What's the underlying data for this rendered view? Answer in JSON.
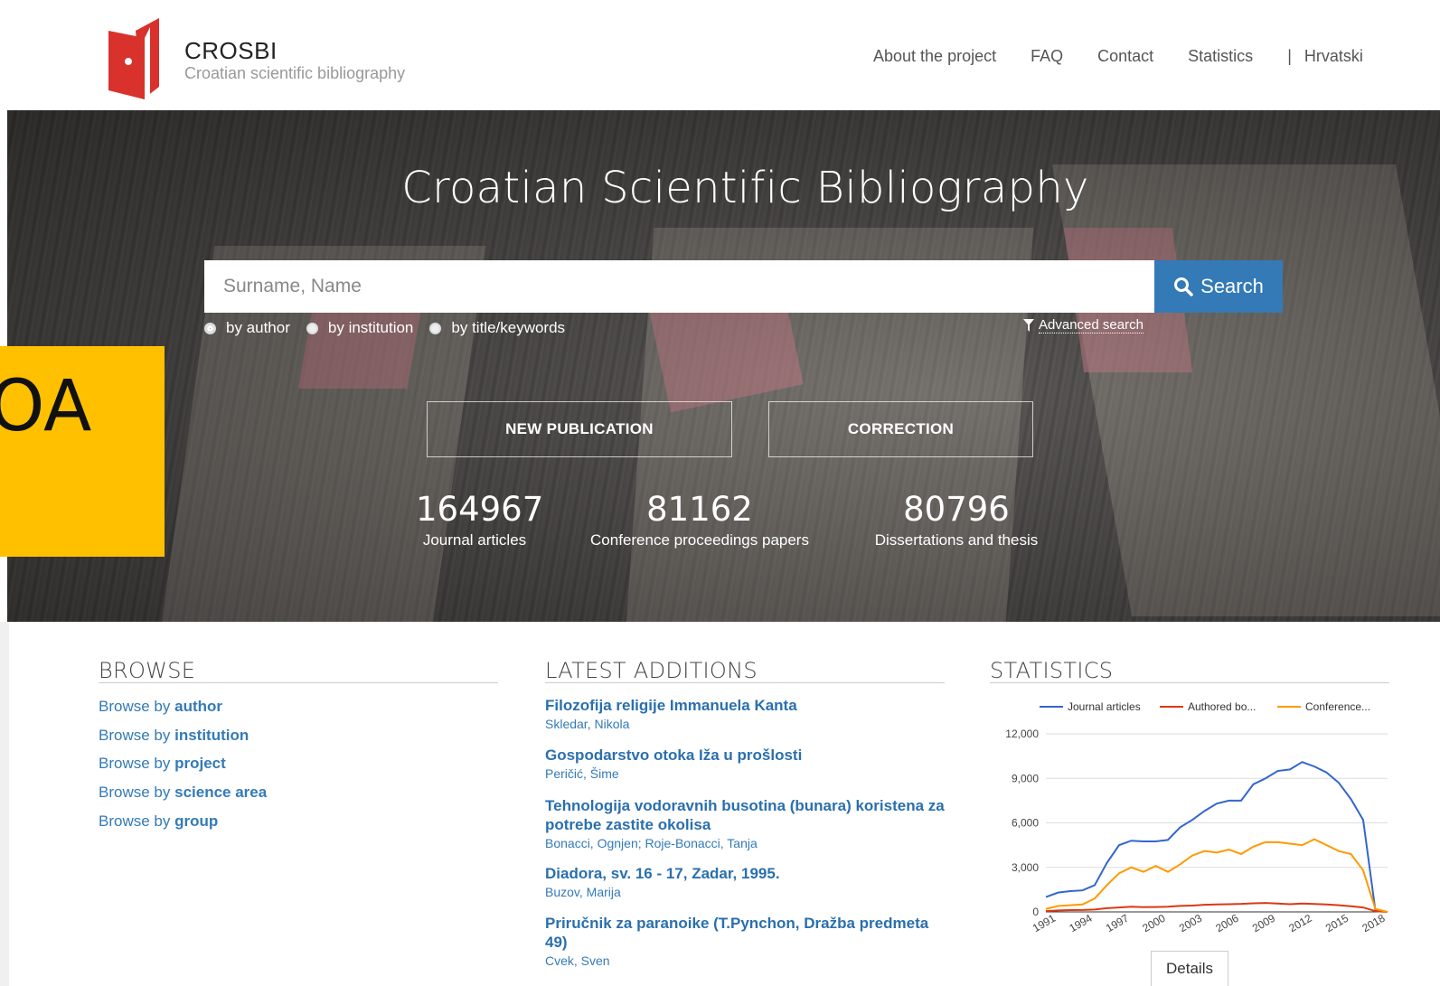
{
  "brand": {
    "name": "CROSBI",
    "subtitle": "Croatian scientific bibliography"
  },
  "nav": {
    "items": [
      "About the project",
      "FAQ",
      "Contact",
      "Statistics"
    ],
    "separator": "|",
    "language": "Hrvatski"
  },
  "hero": {
    "title": "Croatian Scientific Bibliography",
    "search_placeholder": "Surname, Name",
    "search_button": "Search",
    "radio_options": [
      "by author",
      "by institution",
      "by title/keywords"
    ],
    "radio_selected": "by author",
    "advanced_search": "Advanced search",
    "new_publication": "NEW PUBLICATION",
    "correction": "CORRECTION",
    "stats": [
      {
        "value": "164967",
        "label": "Journal articles"
      },
      {
        "value": "81162",
        "label": "Conference proceedings papers"
      },
      {
        "value": "80796",
        "label": "Dissertations and thesis"
      }
    ]
  },
  "overlay": {
    "text": "OA",
    "color": "#ffc000"
  },
  "browse": {
    "title": "BROWSE",
    "prefix": "Browse by",
    "items": [
      "author",
      "institution",
      "project",
      "science area",
      "group"
    ]
  },
  "latest": {
    "title": "LATEST ADDITIONS",
    "items": [
      {
        "title": "Filozofija religije Immanuela Kanta",
        "author": "Skledar, Nikola"
      },
      {
        "title": "Gospodarstvo otoka Iža u prošlosti",
        "author": "Peričić, Šime"
      },
      {
        "title": "Tehnologija vodoravnih busotina (bunara) koristena za potrebe zastite okolisa",
        "author": "Bonacci, Ognjen; Roje-Bonacci, Tanja"
      },
      {
        "title": "Diadora, sv. 16 - 17, Zadar, 1995.",
        "author": "Buzov, Marija"
      },
      {
        "title": "Priručnik za paranoike (T.Pynchon, Dražba predmeta 49)",
        "author": "Cvek, Sven"
      }
    ]
  },
  "statistics": {
    "title": "STATISTICS",
    "details_button": "Details"
  },
  "colors": {
    "accent": "#337ab7",
    "logo_red": "#d9312b",
    "journal": "#3366cc",
    "authored": "#dc3912",
    "conference": "#ff9900"
  },
  "chart_data": {
    "type": "line",
    "x": [
      1991,
      1992,
      1993,
      1994,
      1995,
      1996,
      1997,
      1998,
      1999,
      2000,
      2001,
      2002,
      2003,
      2004,
      2005,
      2006,
      2007,
      2008,
      2009,
      2010,
      2011,
      2012,
      2013,
      2014,
      2015,
      2016,
      2017,
      2018,
      2019
    ],
    "xticks": [
      "1991",
      "1994",
      "1997",
      "2000",
      "2003",
      "2006",
      "2009",
      "2012",
      "2015",
      "2018"
    ],
    "yticks": [
      "0",
      "3,000",
      "6,000",
      "9,000",
      "12,000"
    ],
    "ylim": [
      0,
      12000
    ],
    "series": [
      {
        "name": "Journal articles",
        "color": "#3366cc",
        "values": [
          1000,
          1300,
          1400,
          1450,
          1800,
          3300,
          4500,
          4800,
          4750,
          4750,
          4850,
          5700,
          6200,
          6800,
          7300,
          7500,
          7500,
          8600,
          9000,
          9500,
          9600,
          10100,
          9800,
          9400,
          8700,
          7600,
          6200,
          100,
          0
        ]
      },
      {
        "name": "Authored bo...",
        "color": "#dc3912",
        "values": [
          50,
          100,
          120,
          130,
          160,
          250,
          300,
          350,
          320,
          330,
          350,
          400,
          430,
          480,
          500,
          520,
          540,
          580,
          600,
          560,
          520,
          560,
          530,
          500,
          450,
          380,
          300,
          50,
          0
        ]
      },
      {
        "name": "Conference...",
        "color": "#ff9900",
        "values": [
          200,
          400,
          450,
          500,
          900,
          1800,
          2600,
          3000,
          2700,
          3100,
          2700,
          3200,
          3800,
          4100,
          4000,
          4200,
          3900,
          4400,
          4700,
          4700,
          4600,
          4500,
          4900,
          4500,
          4100,
          3900,
          2800,
          200,
          0
        ]
      }
    ]
  }
}
